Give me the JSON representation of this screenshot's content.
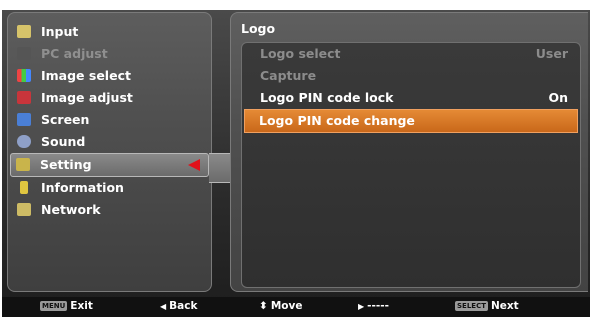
{
  "left_menu": {
    "items": [
      {
        "label": "Input",
        "state": "normal",
        "icon": "input-icon",
        "color": "#d6c36a"
      },
      {
        "label": "PC adjust",
        "state": "disabled",
        "icon": "pc-adjust-icon",
        "color": "#6a6a6a"
      },
      {
        "label": "Image select",
        "state": "normal",
        "icon": "image-select-icon",
        "color": "#e4574b"
      },
      {
        "label": "Image adjust",
        "state": "normal",
        "icon": "image-adjust-icon",
        "color": "#c8353b"
      },
      {
        "label": "Screen",
        "state": "normal",
        "icon": "screen-icon",
        "color": "#4a7fd6"
      },
      {
        "label": "Sound",
        "state": "normal",
        "icon": "sound-icon",
        "color": "#8fa0c8"
      },
      {
        "label": "Setting",
        "state": "active",
        "icon": "setting-icon",
        "color": "#c9b44b"
      },
      {
        "label": "Information",
        "state": "normal",
        "icon": "information-icon",
        "color": "#e0c640"
      },
      {
        "label": "Network",
        "state": "normal",
        "icon": "network-icon",
        "color": "#cdbb65"
      }
    ]
  },
  "submenu": {
    "title": "Logo",
    "items": [
      {
        "label": "Logo select",
        "value": "User",
        "state": "disabled"
      },
      {
        "label": "Capture",
        "value": "",
        "state": "disabled"
      },
      {
        "label": "Logo PIN code lock",
        "value": "On",
        "state": "normal"
      },
      {
        "label": "Logo PIN code change",
        "value": "",
        "state": "selected"
      }
    ]
  },
  "footer": {
    "exit_key": "MENU",
    "exit": "Exit",
    "back_symbol": "◀",
    "back": "Back",
    "move_symbol": "⬍",
    "move": "Move",
    "forward_symbol": "▶",
    "forward": "-----",
    "next_key": "SELECT",
    "next": "Next"
  },
  "colors": {
    "accent": "#d87a2a",
    "active_arrow": "#e0111b"
  }
}
